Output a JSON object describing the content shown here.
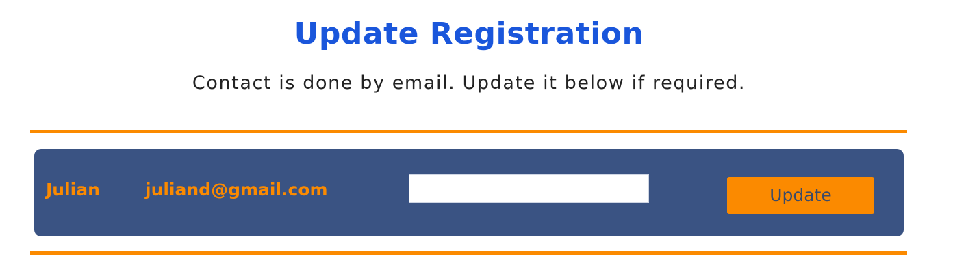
{
  "colors": {
    "title": "#1a56db",
    "accent_orange": "#fb8a00",
    "panel_bg": "#3a5383",
    "button_text": "#3a4a6a",
    "subtitle_text": "#222222"
  },
  "header": {
    "title": "Update Registration",
    "subtitle": "Contact is done by email. Update it below if required."
  },
  "registration": {
    "name": "Julian",
    "email": "juliand@gmail.com",
    "new_email_input": {
      "value": "",
      "placeholder": ""
    },
    "update_label": "Update"
  }
}
